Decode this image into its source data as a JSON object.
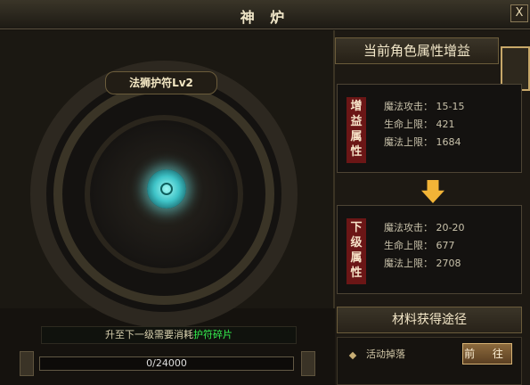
{
  "window": {
    "title": "神 炉",
    "close_label": "X"
  },
  "left": {
    "item_name": "法狮护符Lv2",
    "note_prefix": "升至下一级需要消耗",
    "note_highlight": "护符碎片",
    "progress_text": "0/24000",
    "progress_value": 0
  },
  "right": {
    "header": "当前角色属性增益",
    "current": {
      "tag": "增益属性",
      "lines": [
        "魔法攻击： 15-15",
        "生命上限： 421",
        "魔法上限： 1684"
      ]
    },
    "next": {
      "tag": "下级属性",
      "lines": [
        "魔法攻击： 20-20",
        "生命上限： 677",
        "魔法上限： 2708"
      ]
    },
    "materials": {
      "header": "材料获得途径",
      "source": "活动掉落",
      "button": "前 往"
    }
  },
  "colors": {
    "highlight": "#35ef4e",
    "accent": "#f2b437",
    "tag_red": "#6b1616"
  },
  "icons": [
    "close-icon",
    "orb-icon",
    "down-arrow-icon",
    "diamond-icon"
  ]
}
